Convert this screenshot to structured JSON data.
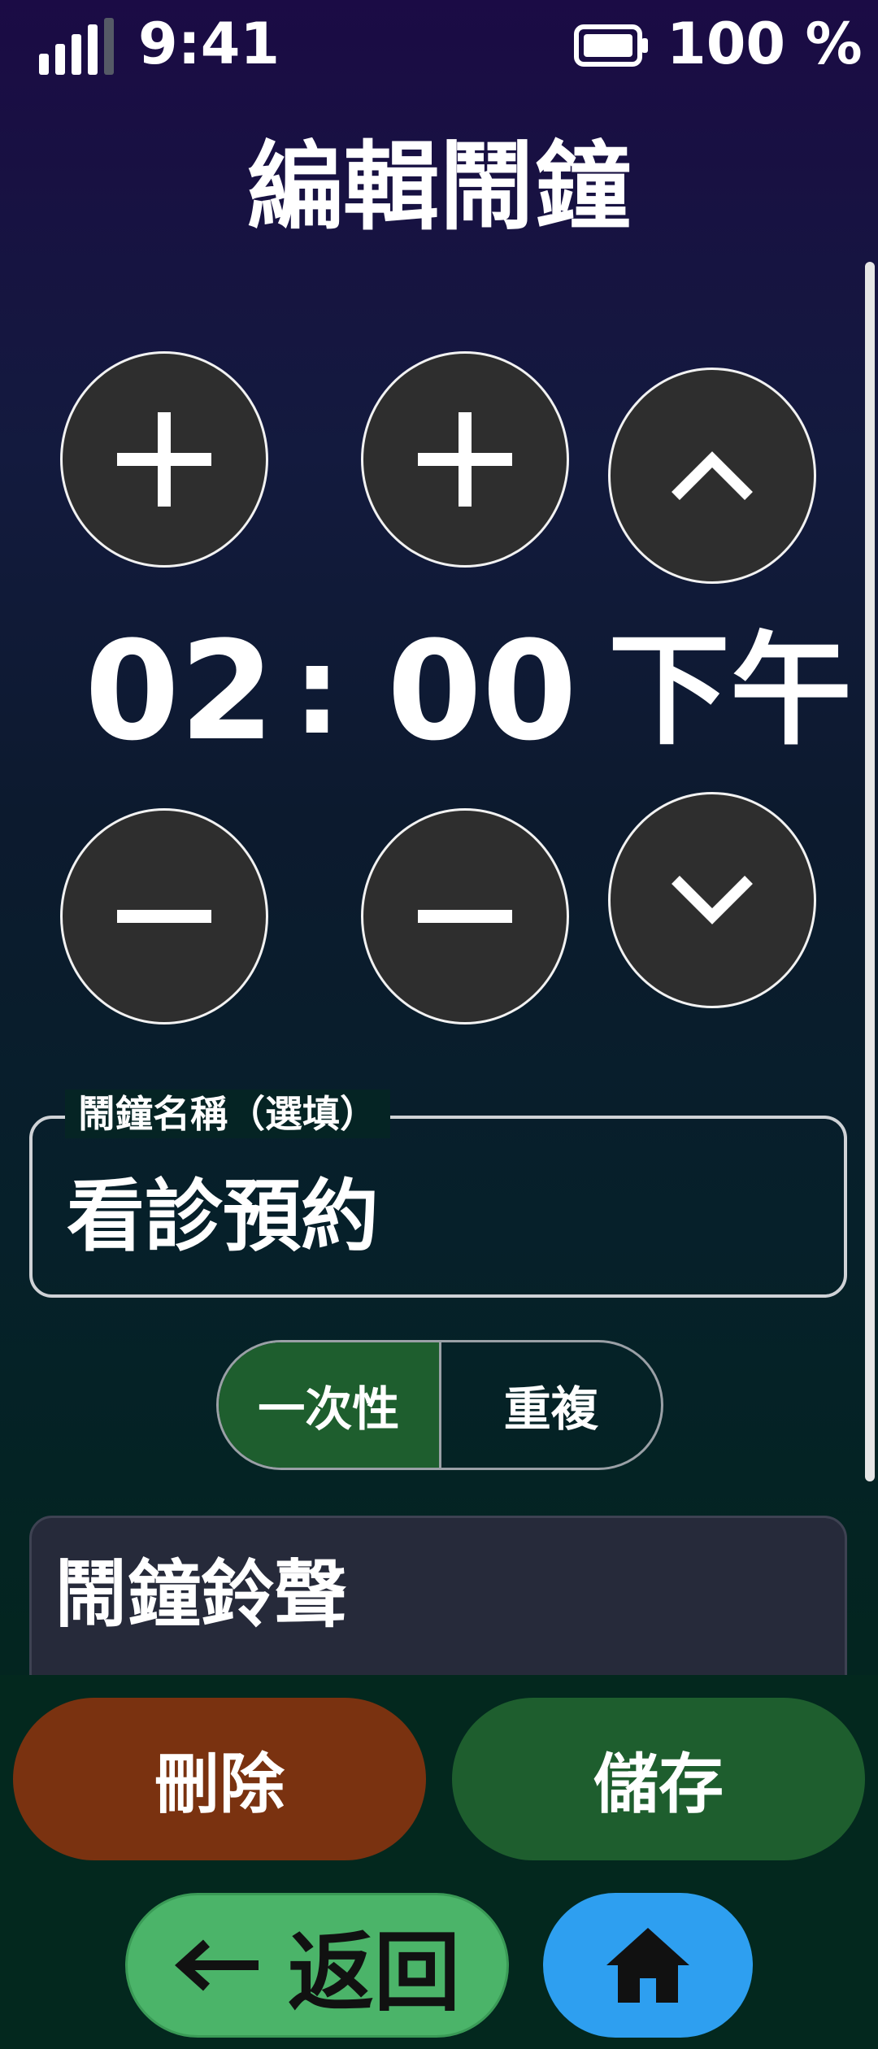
{
  "status_bar": {
    "time": "9:41",
    "battery_percent": "100 %",
    "signal_icon": "signal-icon",
    "battery_icon": "battery-icon"
  },
  "header": {
    "title": "編輯鬧鐘"
  },
  "time_picker": {
    "hour": "02",
    "separator": ":",
    "minute": "00",
    "period": "下午"
  },
  "alarm_name": {
    "label": "鬧鐘名稱（選填）",
    "value": "看診預約"
  },
  "frequency": {
    "options": [
      "一次性",
      "重複"
    ],
    "selected": "一次性"
  },
  "ringtone": {
    "title": "鬧鐘鈴聲"
  },
  "actions": {
    "delete_label": "刪除",
    "save_label": "儲存"
  },
  "nav": {
    "back_label": "返回"
  },
  "colors": {
    "delete": "#7a3210",
    "save": "#1e5e2e",
    "back": "#4bb469",
    "home": "#2e9ff0",
    "segment_active": "#1e5e2e"
  }
}
